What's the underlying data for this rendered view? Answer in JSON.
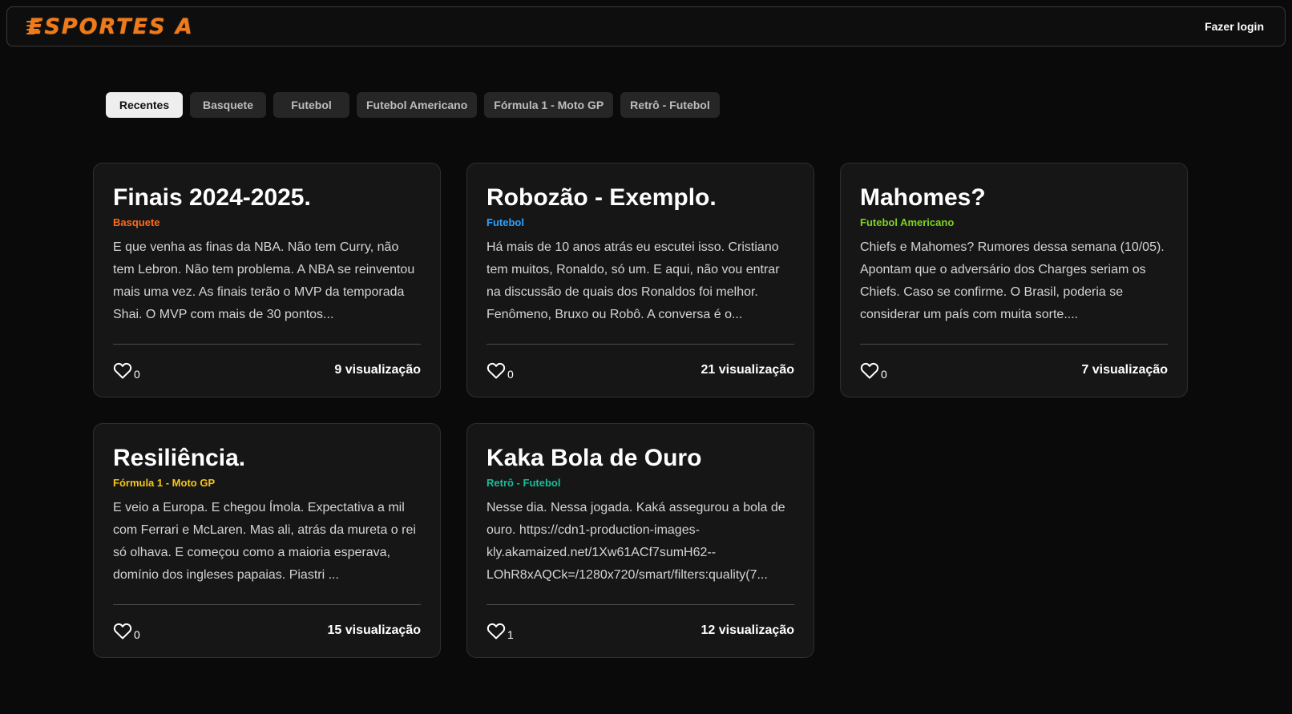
{
  "header": {
    "logo_text": "ESPORTES A",
    "login_label": "Fazer login"
  },
  "tabs": [
    {
      "label": "Recentes",
      "active": true
    },
    {
      "label": "Basquete",
      "active": false
    },
    {
      "label": "Futebol",
      "active": false
    },
    {
      "label": "Futebol Americano",
      "active": false
    },
    {
      "label": "Fórmula 1 - Moto GP",
      "active": false
    },
    {
      "label": "Retrô - Futebol",
      "active": false
    }
  ],
  "colors": {
    "brand": "#f07a1a",
    "basquete": "#ff6a1a",
    "futebol": "#2aa3ff",
    "futebol_americano": "#7ed321",
    "formula": "#f5c518",
    "retro": "#1abc9c"
  },
  "posts": [
    {
      "title": "Finais 2024-2025.",
      "category": "Basquete",
      "excerpt": "E que venha as finas da NBA. Não tem Curry, não tem Lebron. Não tem problema. A NBA se reinventou mais uma vez. As finais terão o MVP da temporada Shai. O MVP com mais de 30 pontos...",
      "likes": "0",
      "views": "9 visualização"
    },
    {
      "title": "Robozão - Exemplo.",
      "category": "Futebol",
      "excerpt": "Há mais de 10 anos atrás eu escutei isso. Cristiano tem muitos, Ronaldo, só um. E aqui, não vou entrar na discussão de quais dos Ronaldos foi melhor. Fenômeno, Bruxo ou Robô. A conversa é o...",
      "likes": "0",
      "views": "21 visualização"
    },
    {
      "title": "Mahomes?",
      "category": "Futebol Americano",
      "excerpt": "Chiefs e Mahomes? Rumores dessa semana (10/05). Apontam que o adversário dos Charges seriam os Chiefs. Caso se confirme. O Brasil, poderia se considerar um país com muita sorte....",
      "likes": "0",
      "views": "7 visualização"
    },
    {
      "title": "Resiliência.",
      "category": "Fórmula 1 - Moto GP",
      "excerpt": "E veio a Europa. E chegou Ímola. Expectativa a mil com Ferrari e McLaren. Mas ali, atrás da mureta o rei só olhava. E começou como a maioria esperava, domínio dos ingleses papaias. Piastri ...",
      "likes": "0",
      "views": "15 visualização"
    },
    {
      "title": "Kaka Bola de Ouro",
      "category": "Retrô - Futebol",
      "excerpt": "Nesse dia. Nessa jogada. Kaká assegurou a bola de ouro. https://cdn1-production-images-kly.akamaized.net/1Xw61ACf7sumH62--LOhR8xAQCk=/1280x720/smart/filters:quality(7...",
      "likes": "1",
      "views": "12 visualização"
    }
  ]
}
